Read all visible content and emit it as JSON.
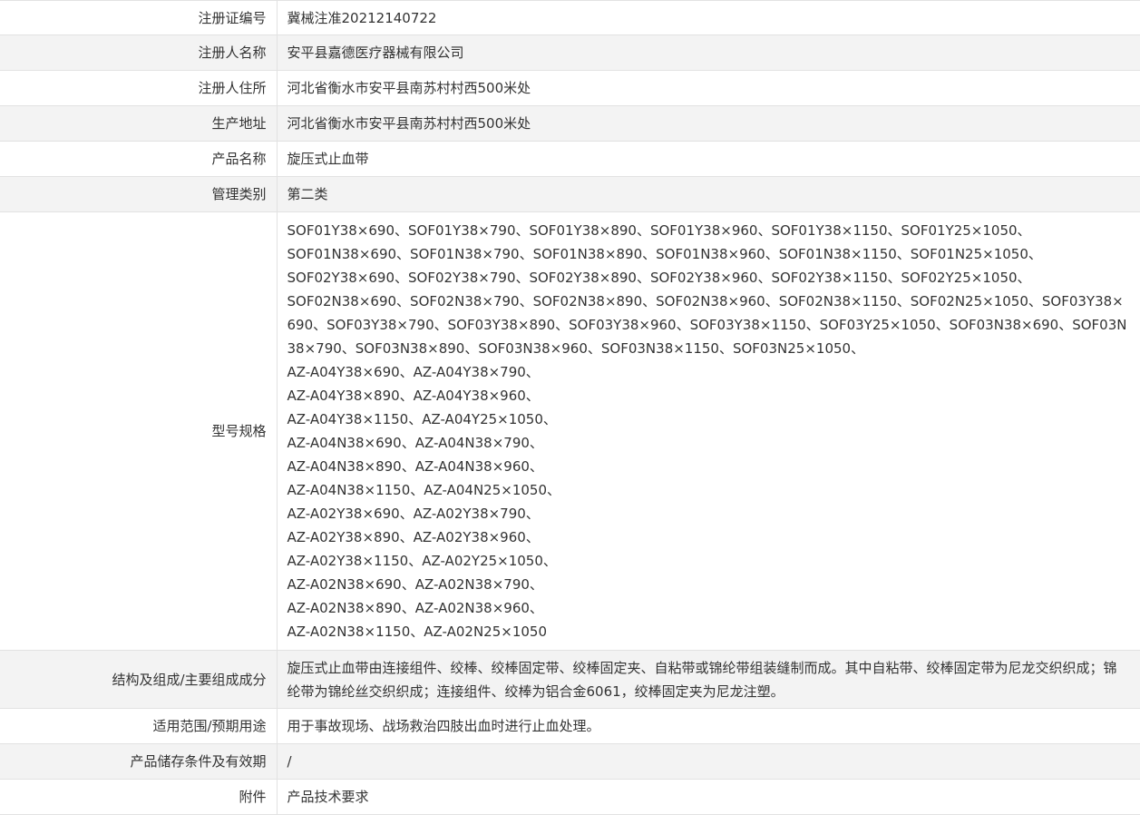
{
  "rows": [
    {
      "label": "注册证编号",
      "value": "冀械注准20212140722"
    },
    {
      "label": "注册人名称",
      "value": "安平县嘉德医疗器械有限公司"
    },
    {
      "label": "注册人住所",
      "value": "河北省衡水市安平县南苏村村西500米处"
    },
    {
      "label": "生产地址",
      "value": "河北省衡水市安平县南苏村村西500米处"
    },
    {
      "label": "产品名称",
      "value": "旋压式止血带"
    },
    {
      "label": "管理类别",
      "value": "第二类"
    },
    {
      "label": "型号规格",
      "value": "SOF01Y38×690、SOF01Y38×790、SOF01Y38×890、SOF01Y38×960、SOF01Y38×1150、SOF01Y25×1050、\nSOF01N38×690、SOF01N38×790、SOF01N38×890、SOF01N38×960、SOF01N38×1150、SOF01N25×1050、\nSOF02Y38×690、SOF02Y38×790、SOF02Y38×890、SOF02Y38×960、SOF02Y38×1150、SOF02Y25×1050、\nSOF02N38×690、SOF02N38×790、SOF02N38×890、SOF02N38×960、SOF02N38×1150、SOF02N25×1050、SOF03Y38×690、SOF03Y38×790、SOF03Y38×890、SOF03Y38×960、SOF03Y38×1150、SOF03Y25×1050、SOF03N38×690、SOF03N38×790、SOF03N38×890、SOF03N38×960、SOF03N38×1150、SOF03N25×1050、\nAZ-A04Y38×690、AZ-A04Y38×790、\nAZ-A04Y38×890、AZ-A04Y38×960、\nAZ-A04Y38×1150、AZ-A04Y25×1050、\nAZ-A04N38×690、AZ-A04N38×790、\nAZ-A04N38×890、AZ-A04N38×960、\nAZ-A04N38×1150、AZ-A04N25×1050、\nAZ-A02Y38×690、AZ-A02Y38×790、\nAZ-A02Y38×890、AZ-A02Y38×960、\nAZ-A02Y38×1150、AZ-A02Y25×1050、\nAZ-A02N38×690、AZ-A02N38×790、\nAZ-A02N38×890、AZ-A02N38×960、\nAZ-A02N38×1150、AZ-A02N25×1050"
    },
    {
      "label": "结构及组成/主要组成成分",
      "value": "旋压式止血带由连接组件、绞棒、绞棒固定带、绞棒固定夹、自粘带或锦纶带组装缝制而成。其中自粘带、绞棒固定带为尼龙交织织成；锦纶带为锦纶丝交织织成；连接组件、绞棒为铝合金6061，绞棒固定夹为尼龙注塑。"
    },
    {
      "label": "适用范围/预期用途",
      "value": "用于事故现场、战场救治四肢出血时进行止血处理。"
    },
    {
      "label": "产品储存条件及有效期",
      "value": "/"
    },
    {
      "label": "附件",
      "value": "产品技术要求"
    }
  ]
}
